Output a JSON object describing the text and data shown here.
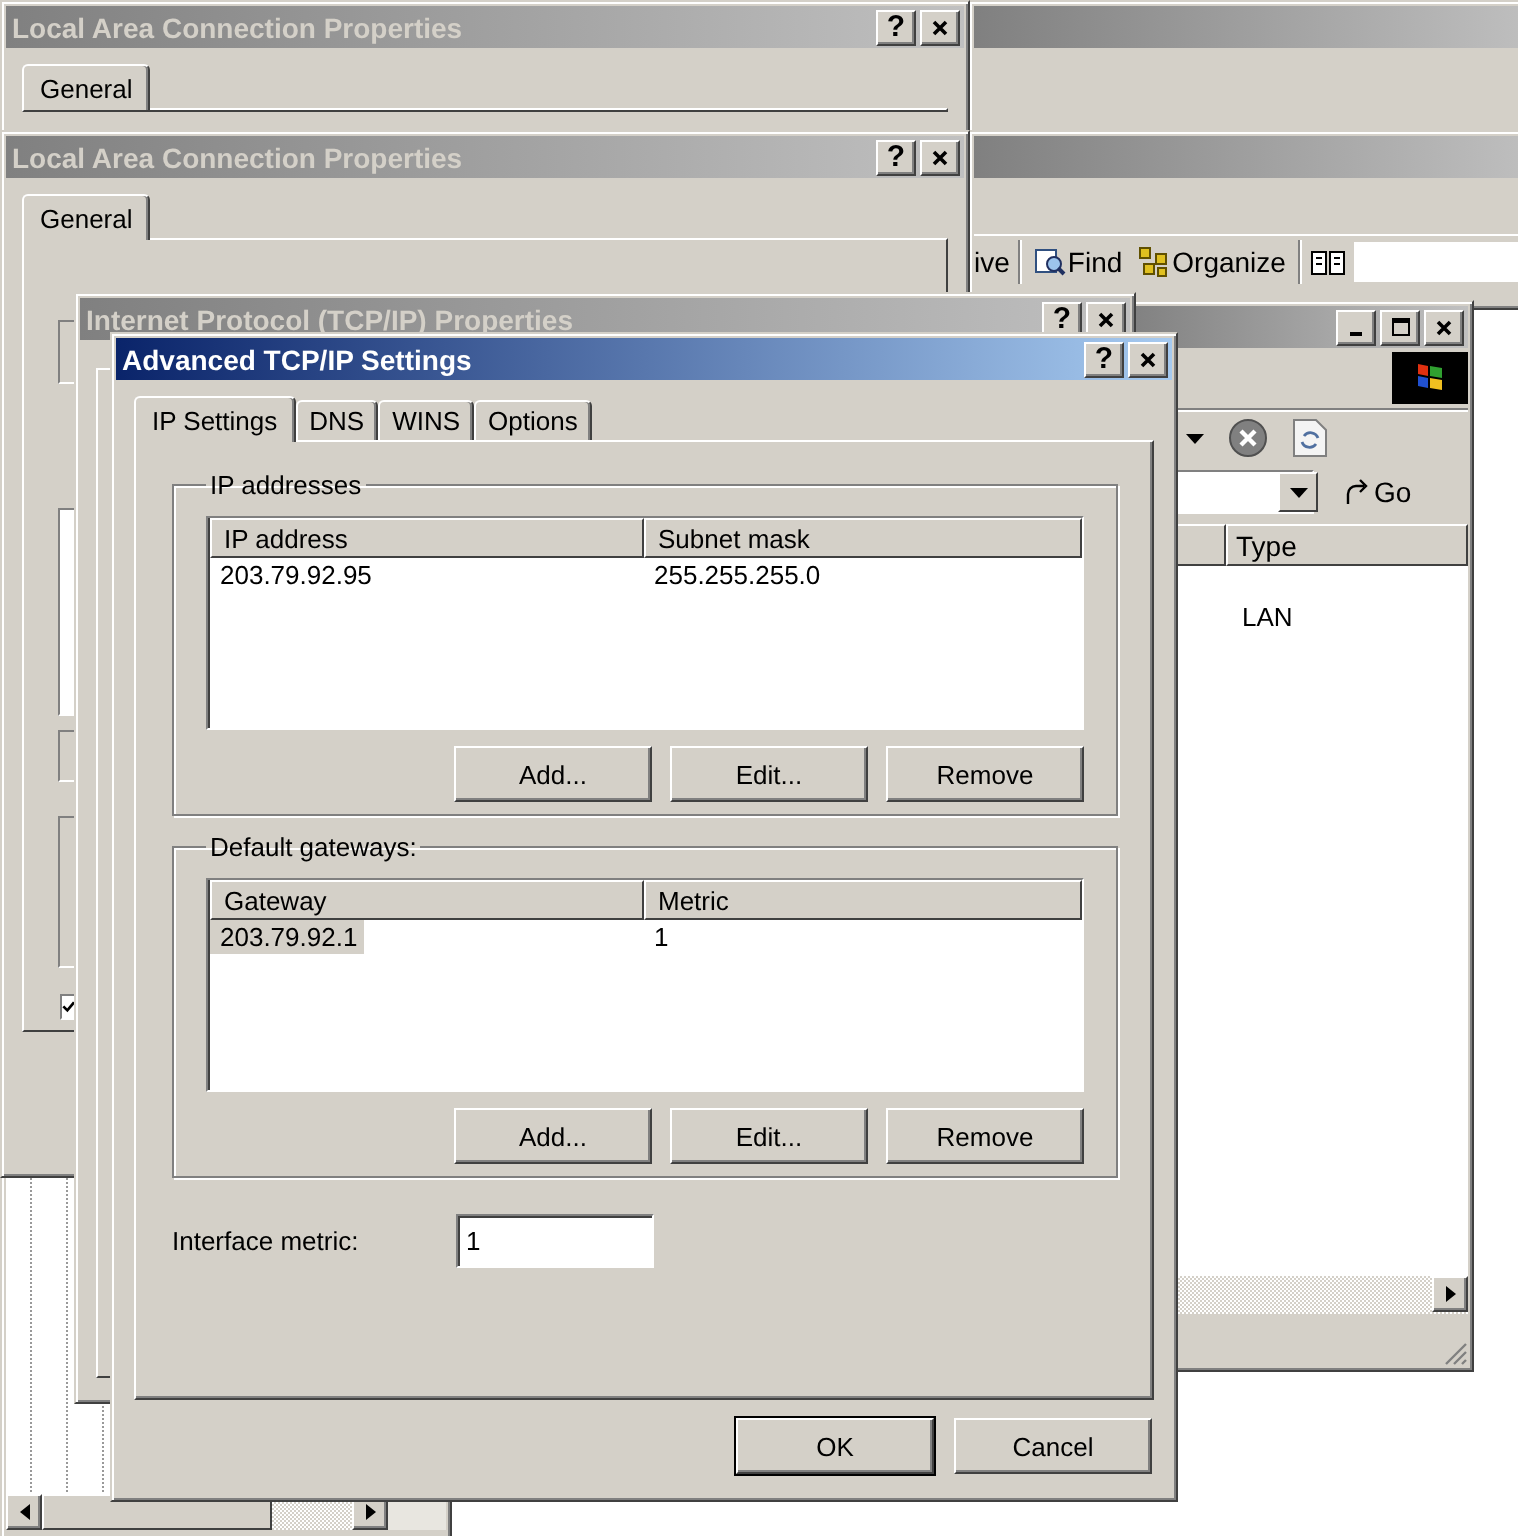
{
  "explorer_windows": [
    {
      "active": false
    },
    {
      "active": false,
      "toolbar": [
        {
          "kind": "text",
          "label": "ive"
        },
        {
          "kind": "find",
          "label": "Find"
        },
        {
          "kind": "organize",
          "label": "Organize"
        },
        {
          "kind": "book"
        }
      ]
    }
  ],
  "browser_window": {
    "active": false,
    "go_button": "Go",
    "columns": [
      "Type"
    ],
    "rows": [
      [
        "LAN"
      ]
    ]
  },
  "properties_windows": [
    {
      "title": "Local Area Connection Properties",
      "active": false,
      "help_button": "?",
      "tabs": [
        {
          "label": "General",
          "selected": true
        }
      ]
    },
    {
      "title": "Local Area Connection Properties",
      "active": false,
      "help_button": "?",
      "tabs": [
        {
          "label": "General",
          "selected": true
        }
      ],
      "checkbox": {
        "checked": true
      }
    }
  ],
  "tcpip_window": {
    "title": "Internet Protocol (TCP/IP) Properties",
    "active": false,
    "help_button": "?"
  },
  "dialog": {
    "title": "Advanced TCP/IP Settings",
    "active": true,
    "help_button": "?",
    "tabs": [
      {
        "label": "IP Settings",
        "selected": true
      },
      {
        "label": "DNS",
        "selected": false
      },
      {
        "label": "WINS",
        "selected": false
      },
      {
        "label": "Options",
        "selected": false
      }
    ],
    "groups": [
      {
        "legend": "IP addresses",
        "columns": [
          "IP address",
          "Subnet mask"
        ],
        "rows": [
          {
            "cells": [
              "203.79.92.95",
              "255.255.255.0"
            ],
            "selected": false
          }
        ],
        "buttons": [
          "Add...",
          "Edit...",
          "Remove"
        ]
      },
      {
        "legend": "Default gateways:",
        "columns": [
          "Gateway",
          "Metric"
        ],
        "rows": [
          {
            "cells": [
              "203.79.92.1",
              "1"
            ],
            "selected": true
          }
        ],
        "buttons": [
          "Add...",
          "Edit...",
          "Remove"
        ]
      }
    ],
    "metric": {
      "label": "Interface metric:",
      "value": "1"
    },
    "buttons": [
      {
        "label": "OK",
        "default": true
      },
      {
        "label": "Cancel",
        "default": false
      }
    ]
  }
}
